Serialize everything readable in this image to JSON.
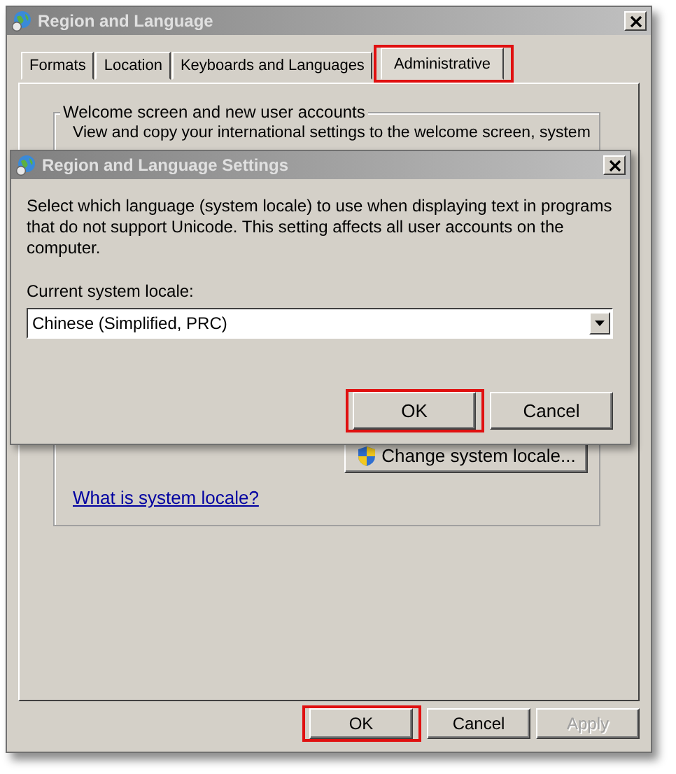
{
  "main_window": {
    "title": "Region and Language",
    "tabs": [
      {
        "label": "Formats",
        "selected": false,
        "highlighted": false
      },
      {
        "label": "Location",
        "selected": false,
        "highlighted": false
      },
      {
        "label": "Keyboards and Languages",
        "selected": false,
        "highlighted": false
      },
      {
        "label": "Administrative",
        "selected": true,
        "highlighted": true
      }
    ],
    "group": {
      "legend": "Welcome screen and new user accounts",
      "text": "View and copy your international settings to the welcome screen, system",
      "button": "Change system locale...",
      "link": "What is system locale?"
    },
    "buttons": [
      {
        "label": "OK",
        "disabled": false,
        "highlighted": true
      },
      {
        "label": "Cancel",
        "disabled": false,
        "highlighted": false
      },
      {
        "label": "Apply",
        "disabled": true,
        "highlighted": false
      }
    ]
  },
  "dialog": {
    "title": "Region and Language Settings",
    "description": "Select which language (system locale) to use when displaying text in programs that do not support Unicode. This setting affects all user accounts on the computer.",
    "locale_label": "Current system locale:",
    "locale_value": "Chinese (Simplified, PRC)",
    "buttons": [
      {
        "label": "OK",
        "disabled": false,
        "highlighted": true
      },
      {
        "label": "Cancel",
        "disabled": false,
        "highlighted": false
      }
    ]
  }
}
